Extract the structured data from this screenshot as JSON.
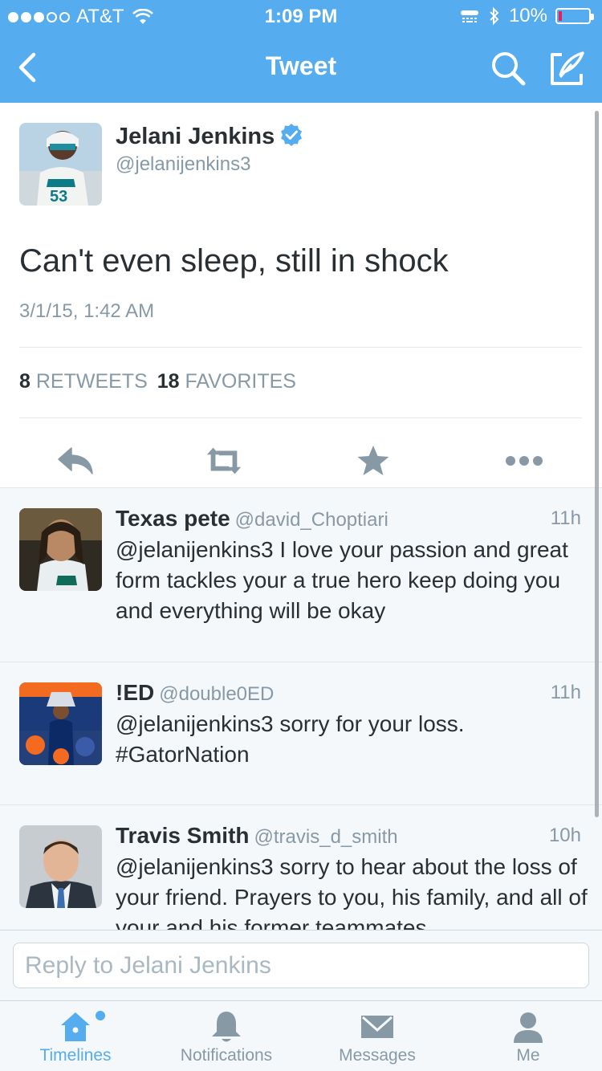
{
  "status_bar": {
    "carrier": "AT&T",
    "time": "1:09 PM",
    "battery": "10%",
    "battery_level": 0.1,
    "signal_bars": 3
  },
  "nav": {
    "title": "Tweet",
    "back_icon": "chevron-left-icon",
    "search_icon": "search-icon",
    "compose_icon": "compose-icon"
  },
  "tweet": {
    "author_name": "Jelani Jenkins",
    "author_handle": "@jelanijenkins3",
    "verified": true,
    "text": "Can't even sleep, still in shock",
    "timestamp": "3/1/15, 1:42 AM",
    "retweets_count": "8",
    "retweets_label": "RETWEETS",
    "favorites_count": "18",
    "favorites_label": "FAVORITES"
  },
  "replies": [
    {
      "name": "Texas pete",
      "handle": "@david_Choptiari",
      "time": "11h",
      "text": "@jelanijenkins3 I love your passion and great form tackles your a true hero keep doing you and everything will be okay"
    },
    {
      "name": "!ED",
      "handle": "@double0ED",
      "time": "11h",
      "text": "@jelanijenkins3 sorry for your loss. #GatorNation"
    },
    {
      "name": "Travis Smith",
      "handle": "@travis_d_smith",
      "time": "10h",
      "text": "@jelanijenkins3 sorry to hear about the loss of your friend. Prayers to you, his family, and all of your and his former teammates"
    }
  ],
  "reply_box": {
    "placeholder": "Reply to Jelani Jenkins",
    "value": ""
  },
  "tabs": [
    {
      "label": "Timelines",
      "icon": "home-icon",
      "active": true
    },
    {
      "label": "Notifications",
      "icon": "bell-icon",
      "active": false
    },
    {
      "label": "Messages",
      "icon": "envelope-icon",
      "active": false
    },
    {
      "label": "Me",
      "icon": "person-icon",
      "active": false
    }
  ],
  "colors": {
    "brand": "#55acee",
    "text": "#292f33",
    "secondary": "#8899a6",
    "background_alt": "#f5f8fa"
  }
}
